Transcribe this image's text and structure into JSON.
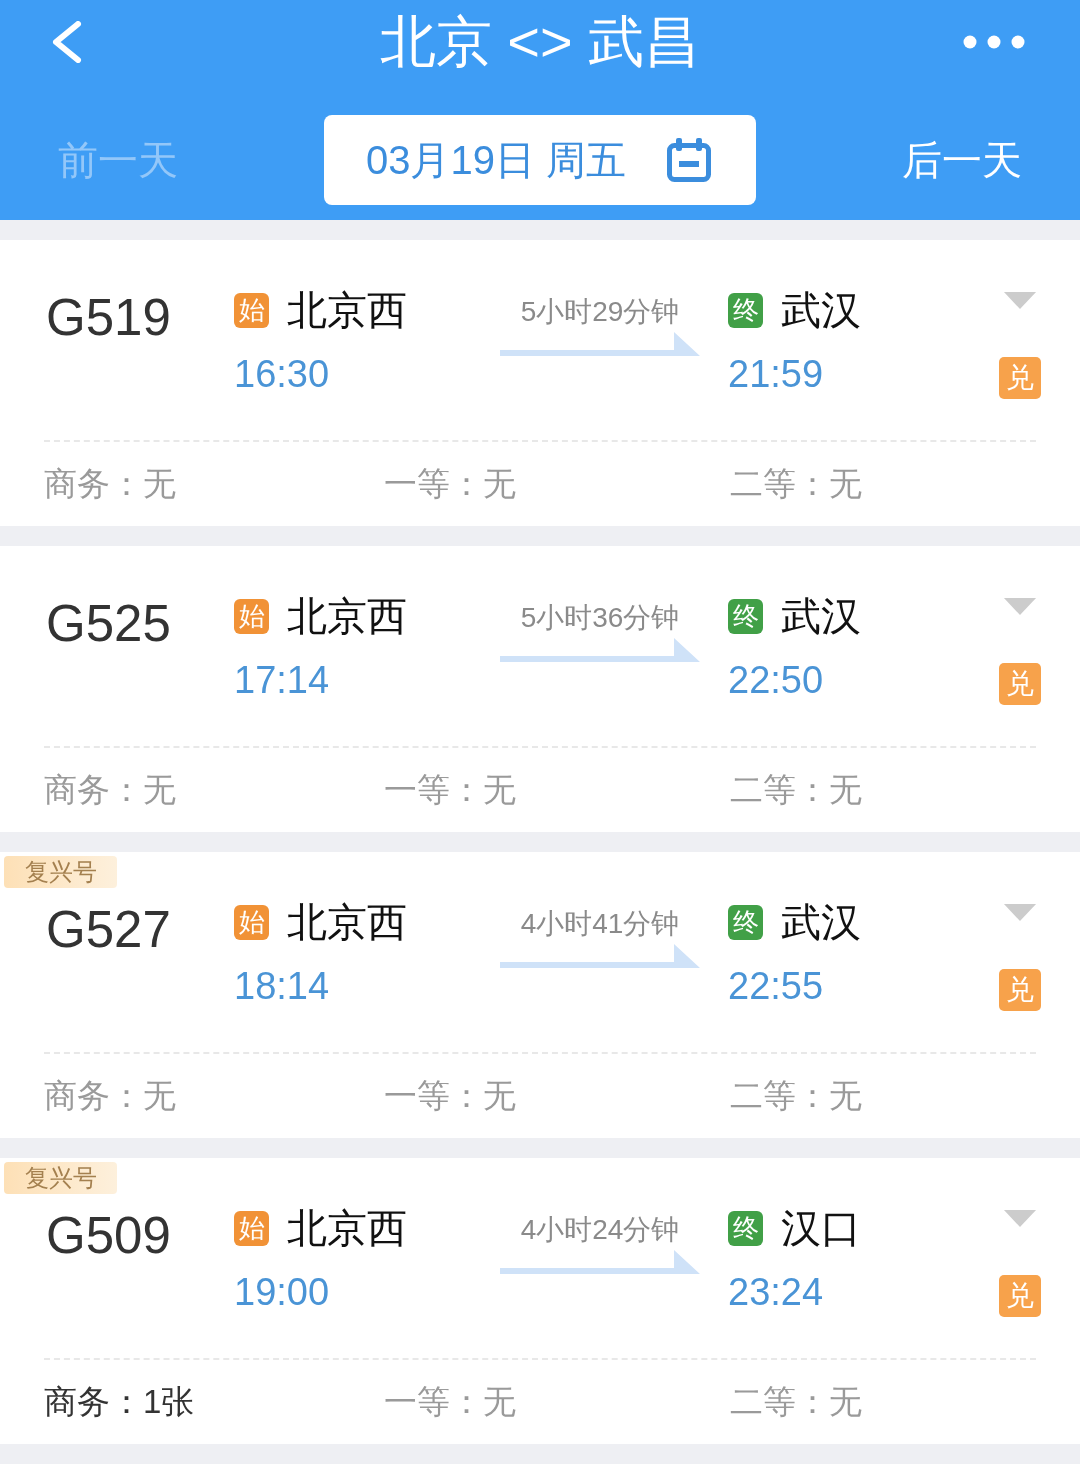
{
  "header": {
    "title": "北京 <> 武昌"
  },
  "date_bar": {
    "prev": {
      "label": "前一天",
      "disabled": true
    },
    "date": "03月19日 周五",
    "next": {
      "label": "后一天",
      "disabled": false
    }
  },
  "trains": [
    {
      "number": "G519",
      "from": {
        "tag": "始",
        "name": "北京西",
        "time": "16:30"
      },
      "duration": "5小时29分钟",
      "to": {
        "tag": "终",
        "name": "武汉",
        "time": "21:59"
      },
      "exchange": "兑",
      "seats": [
        {
          "text": "商务：无",
          "available": false
        },
        {
          "text": "一等：无",
          "available": false
        },
        {
          "text": "二等：无",
          "available": false
        }
      ]
    },
    {
      "number": "G525",
      "from": {
        "tag": "始",
        "name": "北京西",
        "time": "17:14"
      },
      "duration": "5小时36分钟",
      "to": {
        "tag": "终",
        "name": "武汉",
        "time": "22:50"
      },
      "exchange": "兑",
      "seats": [
        {
          "text": "商务：无",
          "available": false
        },
        {
          "text": "一等：无",
          "available": false
        },
        {
          "text": "二等：无",
          "available": false
        }
      ]
    },
    {
      "badge": "复兴号",
      "number": "G527",
      "from": {
        "tag": "始",
        "name": "北京西",
        "time": "18:14"
      },
      "duration": "4小时41分钟",
      "to": {
        "tag": "终",
        "name": "武汉",
        "time": "22:55"
      },
      "exchange": "兑",
      "seats": [
        {
          "text": "商务：无",
          "available": false
        },
        {
          "text": "一等：无",
          "available": false
        },
        {
          "text": "二等：无",
          "available": false
        }
      ]
    },
    {
      "badge": "复兴号",
      "number": "G509",
      "from": {
        "tag": "始",
        "name": "北京西",
        "time": "19:00"
      },
      "duration": "4小时24分钟",
      "to": {
        "tag": "终",
        "name": "汉口",
        "time": "23:24"
      },
      "exchange": "兑",
      "seats": [
        {
          "text": "商务：1张",
          "available": true
        },
        {
          "text": "一等：无",
          "available": false
        },
        {
          "text": "二等：无",
          "available": false
        }
      ]
    }
  ]
}
